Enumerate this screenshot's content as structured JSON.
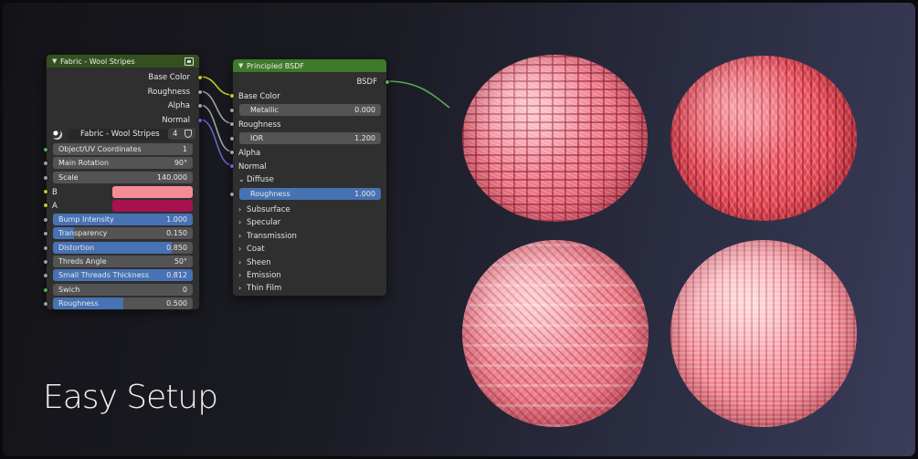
{
  "group_node": {
    "title": "Fabric - Wool Stripes",
    "outputs": [
      "Base Color",
      "Roughness",
      "Alpha",
      "Normal"
    ],
    "selector": {
      "name": "Fabric - Wool Stripes",
      "users": "4"
    },
    "inputs": [
      {
        "label": "Object/UV Coordinates",
        "value": "1",
        "fill": 0
      },
      {
        "label": "Main Rotation",
        "value": "90°",
        "fill": 0
      },
      {
        "label": "Scale",
        "value": "140.000",
        "fill": 0
      }
    ],
    "colors": [
      {
        "label": "B",
        "color": "#f58b96"
      },
      {
        "label": "A",
        "color": "#a7114f"
      }
    ],
    "sliders": [
      {
        "label": "Bump Intensity",
        "value": "1.000",
        "fill": 1.0
      },
      {
        "label": "Transparency",
        "value": "0.150",
        "fill": 0.15
      },
      {
        "label": "Distortion",
        "value": "0.850",
        "fill": 0.85
      },
      {
        "label": "Threds Angle",
        "value": "50°",
        "fill": 0
      },
      {
        "label": "Small Threads Thickness",
        "value": "0.812",
        "fill": 1.0
      },
      {
        "label": "Swich",
        "value": "0",
        "fill": 0
      },
      {
        "label": "Roughness",
        "value": "0.500",
        "fill": 0.5
      }
    ]
  },
  "bsdf_node": {
    "title": "Principled BSDF",
    "output": "BSDF",
    "inputs": {
      "base_color": "Base Color",
      "metallic": {
        "label": "Metallic",
        "value": "0.000"
      },
      "roughness": "Roughness",
      "ior": {
        "label": "IOR",
        "value": "1.200"
      },
      "alpha": "Alpha",
      "normal": "Normal"
    },
    "diffuse": {
      "label": "Diffuse",
      "roughness_label": "Roughness",
      "roughness_value": "1.000"
    },
    "panels": [
      "Subsurface",
      "Specular",
      "Transmission",
      "Coat",
      "Sheen",
      "Emission",
      "Thin Film"
    ]
  },
  "headline": "Easy Setup",
  "accent_colors": {
    "slider": "#4772b3",
    "group_header": "#33511e",
    "shader_header": "#3d7a2a"
  }
}
